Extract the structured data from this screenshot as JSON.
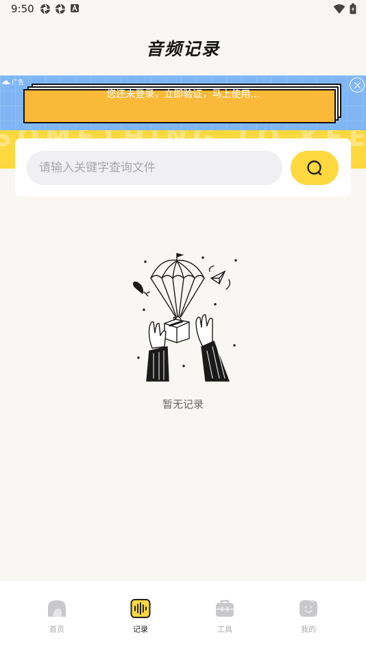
{
  "status_bar": {
    "time": "9:50",
    "left_icons": [
      "shutter-icon",
      "shutter-icon",
      "text-a-icon"
    ],
    "right_icons": [
      "wifi-icon",
      "battery-icon"
    ]
  },
  "header": {
    "title": "音频记录"
  },
  "ad": {
    "tag": "广告",
    "text": "您还未登录，立即验证，马上使用..."
  },
  "search": {
    "placeholder": "请输入关键字查询文件",
    "value": "",
    "button_icon": "search-icon"
  },
  "empty_state": {
    "illustration": "parachute-gift-illustration",
    "text": "暂无记录"
  },
  "bottom_nav": {
    "items": [
      {
        "label": "首页",
        "icon": "home-icon",
        "active": false
      },
      {
        "label": "记录",
        "icon": "audio-record-icon",
        "active": true
      },
      {
        "label": "工具",
        "icon": "toolbox-icon",
        "active": false
      },
      {
        "label": "我的",
        "icon": "profile-icon",
        "active": false
      }
    ]
  },
  "colors": {
    "accent": "#fdd83e",
    "background": "#f8f7f3",
    "ad_background": "#80b6f4",
    "ad_card": "#fbb93a"
  }
}
